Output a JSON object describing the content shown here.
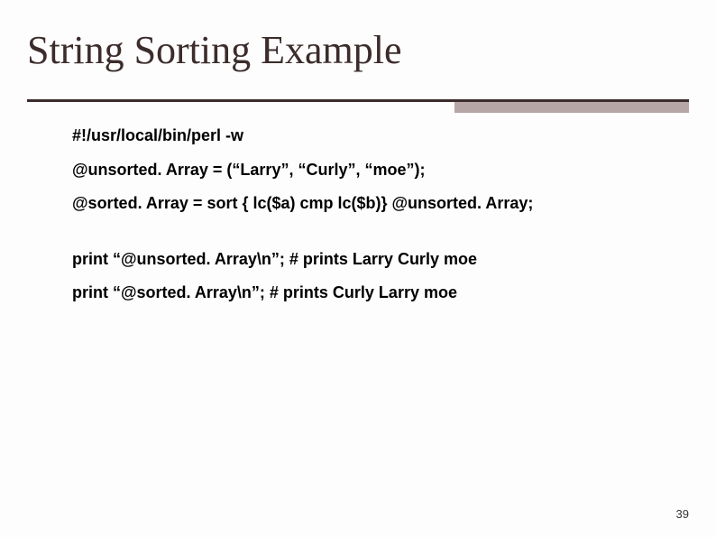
{
  "title": "String Sorting Example",
  "code": {
    "line1": "#!/usr/local/bin/perl -w",
    "line2": "@unsorted. Array = (“Larry”, “Curly”, “moe”);",
    "line3": "@sorted. Array = sort { lc($a) cmp  lc($b)} @unsorted. Array;",
    "line4": "print “@unsorted. Array\\n”; # prints Larry Curly moe",
    "line5": "print “@sorted. Array\\n”;        # prints Curly Larry moe"
  },
  "pageNumber": "39"
}
